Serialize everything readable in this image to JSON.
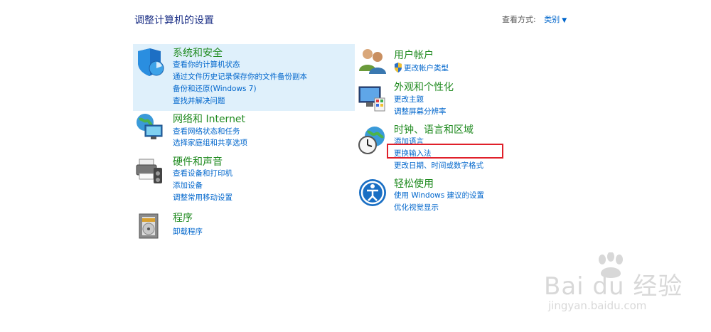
{
  "page": {
    "title": "调整计算机的设置",
    "view_by_label": "查看方式:",
    "view_by_value": "类别"
  },
  "categories": [
    {
      "key": "system-security",
      "icon": "shield-icon",
      "title": "系统和安全",
      "links": [
        "查看你的计算机状态",
        "通过文件历史记录保存你的文件备份副本",
        "备份和还原(Windows 7)",
        "查找并解决问题"
      ]
    },
    {
      "key": "network-internet",
      "icon": "globe-network-icon",
      "title": "网络和 Internet",
      "links": [
        "查看网络状态和任务",
        "选择家庭组和共享选项"
      ]
    },
    {
      "key": "hardware-sound",
      "icon": "printer-speaker-icon",
      "title": "硬件和声音",
      "links": [
        "查看设备和打印机",
        "添加设备",
        "调整常用移动设置"
      ]
    },
    {
      "key": "programs",
      "icon": "programs-disc-icon",
      "title": "程序",
      "links": [
        "卸载程序"
      ]
    },
    {
      "key": "user-accounts",
      "icon": "users-icon",
      "title": "用户帐户",
      "links": [
        "更改帐户类型"
      ]
    },
    {
      "key": "appearance",
      "icon": "monitor-palette-icon",
      "title": "外观和个性化",
      "links": [
        "更改主题",
        "调整屏幕分辨率"
      ]
    },
    {
      "key": "clock-language-region",
      "icon": "clock-globe-icon",
      "title": "时钟、语言和区域",
      "links": [
        "添加语言",
        "更换输入法",
        "更改日期、时间或数字格式"
      ]
    },
    {
      "key": "ease-of-access",
      "icon": "ease-of-access-icon",
      "title": "轻松使用",
      "links": [
        "使用 Windows 建议的设置",
        "优化视觉显示"
      ]
    }
  ],
  "watermark": {
    "logo_text": "Bai du 经验",
    "url": "jingyan.baidu.com"
  },
  "colors": {
    "heading_green": "#1f8a1f",
    "link_blue": "#0066cc",
    "title_blue": "#1e3287",
    "highlight_bg": "#dff0fb",
    "annotation_red": "#e0202a"
  }
}
